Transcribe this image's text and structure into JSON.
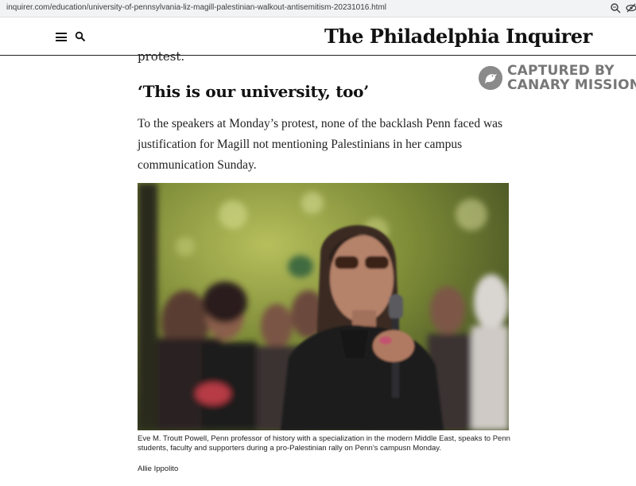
{
  "browser": {
    "url": "inquirer.com/education/university-of-pennsylvania-liz-magill-palestinian-walkout-antisemitism-20231016.html"
  },
  "header": {
    "masthead": "The Philadelphia Inquirer"
  },
  "article": {
    "prev_text": "protest.",
    "subhead": "‘This is our university, too’",
    "paragraph": "To the speakers at Monday’s protest, none of the backlash Penn faced was justification for Magill not mentioning Palestinians in her campus communication Sunday.",
    "photo_caption": "Eve M. Troutt Powell, Penn professor of history with a specialization in the modern Middle East, speaks to Penn students, faculty and supporters during a pro-Palestinian rally on Penn’s campusn Monday.",
    "photo_credit": "Allie Ippolito"
  },
  "watermark": {
    "line1": "CAPTURED BY",
    "line2": "CANARY MISSION"
  }
}
